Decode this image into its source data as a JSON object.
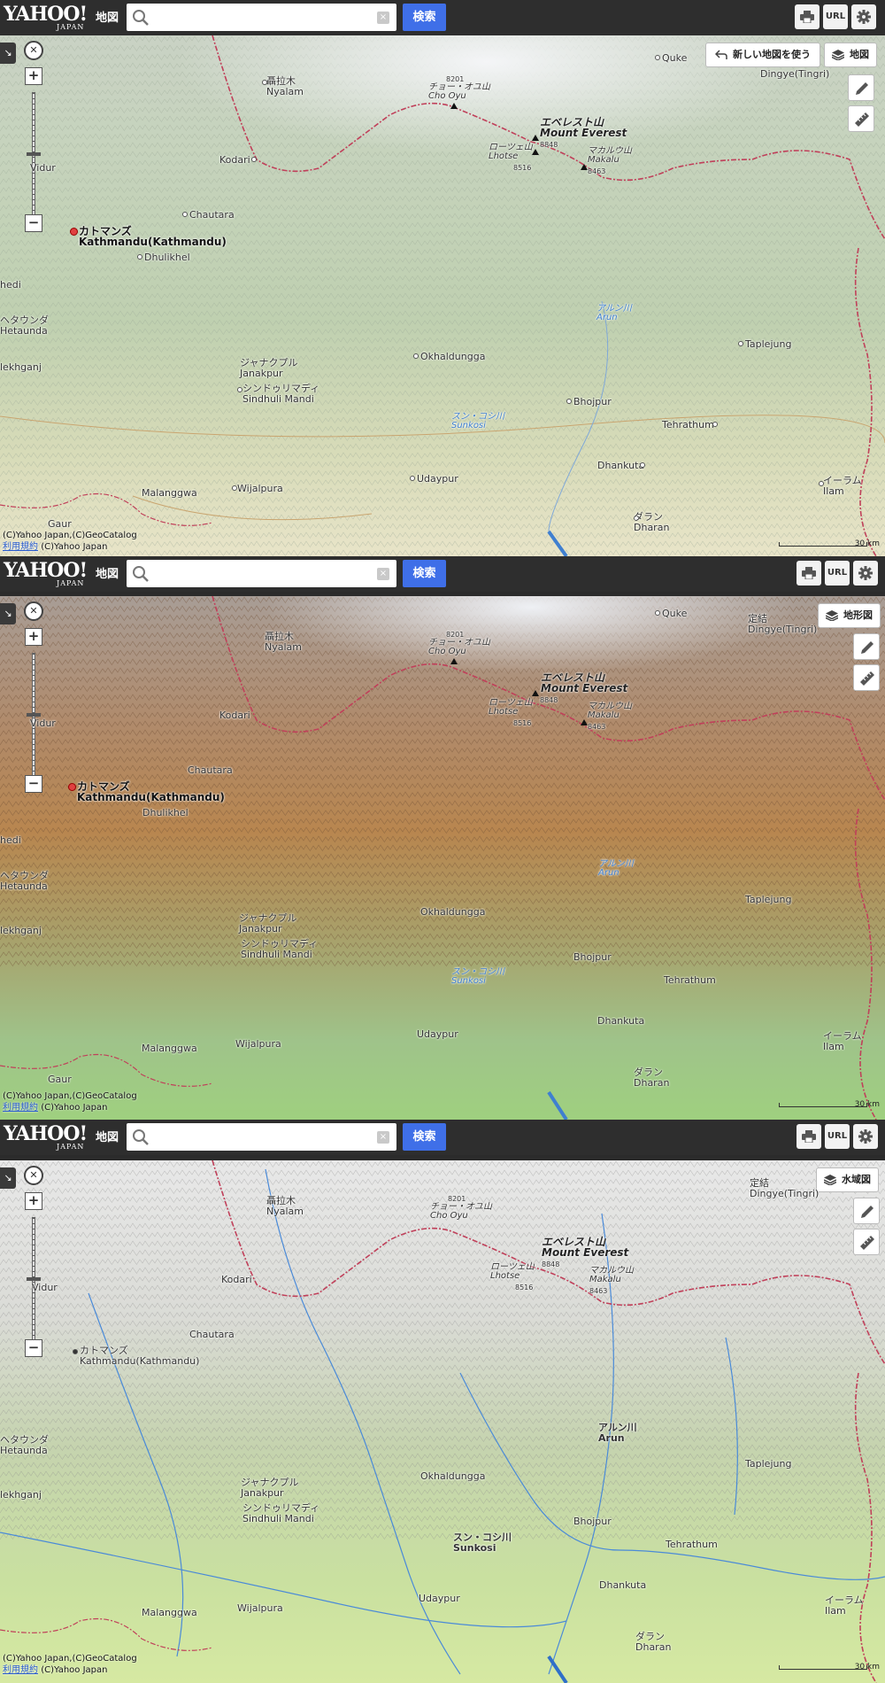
{
  "app": {
    "logo": "YAHOO!",
    "logo_sub": "JAPAN",
    "logo_map": "地図"
  },
  "search": {
    "placeholder": "",
    "value": "",
    "clear": "×",
    "button_label": "検索"
  },
  "top_icons": {
    "print": "print-icon",
    "url_label": "URL",
    "settings": "gear-icon"
  },
  "panels": [
    {
      "map_type_label": "地図",
      "new_map_label": "新しい地図を使う",
      "style": "standard"
    },
    {
      "map_type_label": "地形図",
      "style": "terrain"
    },
    {
      "map_type_label": "水域図",
      "style": "water"
    }
  ],
  "labels": {
    "nyalam_ja": "聶拉木",
    "nyalam": "Nyalam",
    "cho_oyu_elev": "8201",
    "cho_oyu_ja": "チョー・オユ山",
    "cho_oyu": "Cho Oyu",
    "everest_ja": "エベレスト山",
    "everest": "Mount Everest",
    "everest_elev": "8848",
    "lhotse_ja": "ローツェ山",
    "lhotse": "Lhotse",
    "lhotse_elev": "8516",
    "makalu_ja": "マカルウ山",
    "makalu": "Makalu",
    "makalu_elev": "8463",
    "quke": "Quke",
    "dingye_ja": "定結",
    "dingye": "Dingye(Tingri)",
    "kodari": "Kodari",
    "vidur": "Vidur",
    "chautara": "Chautara",
    "kathmandu_ja": "カトマンズ",
    "kathmandu": "Kathmandu(Kathmandu)",
    "dhulikhel": "Dhulikhel",
    "hedi": "hedi",
    "hetaunda_ja": "ヘタウンダ",
    "hetaunda": "Hetaunda",
    "arun_ja": "アルン川",
    "arun": "Arun",
    "okhaldungga": "Okhaldungga",
    "taplejung": "Taplejung",
    "janakpur_ja": "ジャナクプル",
    "janakpur": "Janakpur",
    "sindhuli_ja": "シンドゥリマディ",
    "sindhuli": "Sindhuli Mandi",
    "birganj": "lekhganj",
    "sunkosi_ja": "スン・コシ川",
    "sunkosi": "Sunkosi",
    "bhojpur": "Bhojpur",
    "tehrathum": "Tehrathum",
    "udaypur": "Udaypur",
    "dhankuta": "Dhankuta",
    "ilam_ja": "イーラム",
    "ilam": "Ilam",
    "gaur": "Gaur",
    "malanggwa": "Malanggwa",
    "wijalpura": "Wijalpura",
    "dharan_ja": "ダラン",
    "dharan": "Dharan"
  },
  "footer": {
    "copyright": "(C)Yahoo Japan,(C)GeoCatalog",
    "terms": "利用規約",
    "copyright2": "(C)Yahoo Japan",
    "scale": "30 km"
  },
  "colors": {
    "topbar": "#2e2e2e",
    "search_button": "#3f6fe8",
    "border": "#c0405a",
    "river": "#3f7fd0"
  }
}
